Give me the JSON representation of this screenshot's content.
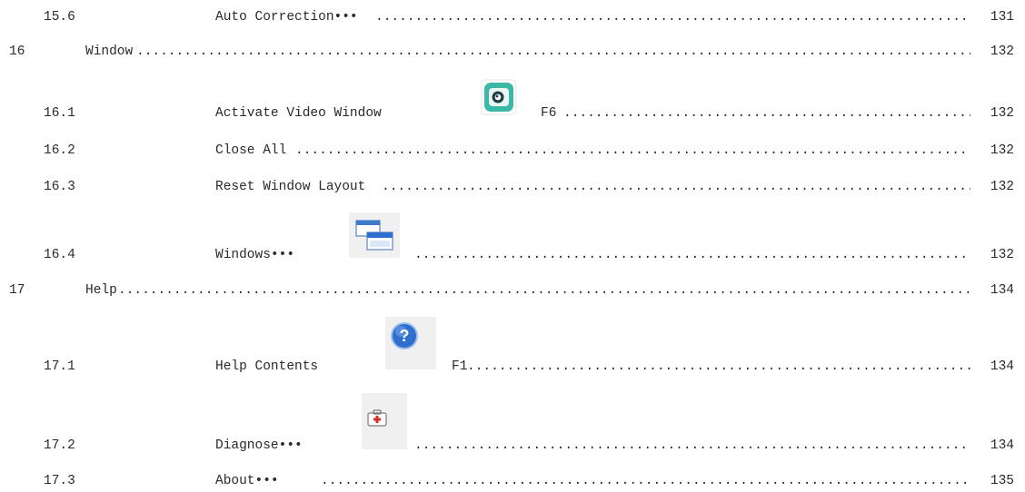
{
  "toc": {
    "entries": [
      {
        "number": "15.6",
        "title": "Auto Correction•••",
        "page": "131"
      },
      {
        "number": "16",
        "title": "Window",
        "page": "132"
      },
      {
        "number": "16.1",
        "title": "Activate Video Window",
        "shortcut": "F6",
        "icon": "video-window-icon",
        "page": "132"
      },
      {
        "number": "16.2",
        "title": "Close All",
        "page": "132"
      },
      {
        "number": "16.3",
        "title": "Reset Window Layout",
        "page": "132"
      },
      {
        "number": "16.4",
        "title": "Windows•••",
        "icon": "windows-icon",
        "page": "132"
      },
      {
        "number": "17",
        "title": "Help",
        "page": "134"
      },
      {
        "number": "17.1",
        "title": "Help Contents",
        "shortcut": "F1",
        "icon": "help-icon",
        "page": "134"
      },
      {
        "number": "17.2",
        "title": "Diagnose•••",
        "icon": "diagnose-icon",
        "page": "134"
      },
      {
        "number": "17.3",
        "title": "About•••",
        "page": "135"
      }
    ]
  },
  "colors": {
    "text": "#2a2a2a",
    "video_icon_bg": "#3bb8a6",
    "help_icon_blue": "#2f6fd0"
  }
}
